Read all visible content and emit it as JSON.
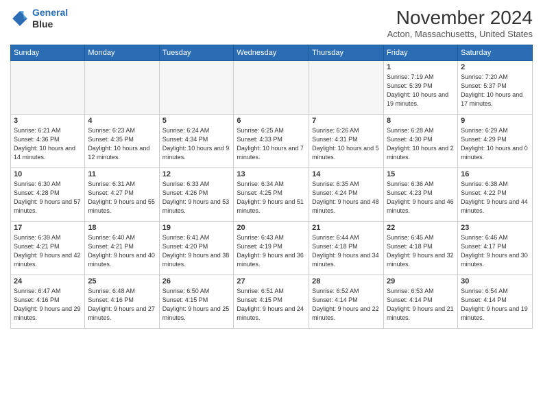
{
  "header": {
    "logo_line1": "General",
    "logo_line2": "Blue",
    "month": "November 2024",
    "location": "Acton, Massachusetts, United States"
  },
  "weekdays": [
    "Sunday",
    "Monday",
    "Tuesday",
    "Wednesday",
    "Thursday",
    "Friday",
    "Saturday"
  ],
  "weeks": [
    [
      {
        "day": "",
        "info": ""
      },
      {
        "day": "",
        "info": ""
      },
      {
        "day": "",
        "info": ""
      },
      {
        "day": "",
        "info": ""
      },
      {
        "day": "",
        "info": ""
      },
      {
        "day": "1",
        "info": "Sunrise: 7:19 AM\nSunset: 5:39 PM\nDaylight: 10 hours and 19 minutes."
      },
      {
        "day": "2",
        "info": "Sunrise: 7:20 AM\nSunset: 5:37 PM\nDaylight: 10 hours and 17 minutes."
      }
    ],
    [
      {
        "day": "3",
        "info": "Sunrise: 6:21 AM\nSunset: 4:36 PM\nDaylight: 10 hours and 14 minutes."
      },
      {
        "day": "4",
        "info": "Sunrise: 6:23 AM\nSunset: 4:35 PM\nDaylight: 10 hours and 12 minutes."
      },
      {
        "day": "5",
        "info": "Sunrise: 6:24 AM\nSunset: 4:34 PM\nDaylight: 10 hours and 9 minutes."
      },
      {
        "day": "6",
        "info": "Sunrise: 6:25 AM\nSunset: 4:33 PM\nDaylight: 10 hours and 7 minutes."
      },
      {
        "day": "7",
        "info": "Sunrise: 6:26 AM\nSunset: 4:31 PM\nDaylight: 10 hours and 5 minutes."
      },
      {
        "day": "8",
        "info": "Sunrise: 6:28 AM\nSunset: 4:30 PM\nDaylight: 10 hours and 2 minutes."
      },
      {
        "day": "9",
        "info": "Sunrise: 6:29 AM\nSunset: 4:29 PM\nDaylight: 10 hours and 0 minutes."
      }
    ],
    [
      {
        "day": "10",
        "info": "Sunrise: 6:30 AM\nSunset: 4:28 PM\nDaylight: 9 hours and 57 minutes."
      },
      {
        "day": "11",
        "info": "Sunrise: 6:31 AM\nSunset: 4:27 PM\nDaylight: 9 hours and 55 minutes."
      },
      {
        "day": "12",
        "info": "Sunrise: 6:33 AM\nSunset: 4:26 PM\nDaylight: 9 hours and 53 minutes."
      },
      {
        "day": "13",
        "info": "Sunrise: 6:34 AM\nSunset: 4:25 PM\nDaylight: 9 hours and 51 minutes."
      },
      {
        "day": "14",
        "info": "Sunrise: 6:35 AM\nSunset: 4:24 PM\nDaylight: 9 hours and 48 minutes."
      },
      {
        "day": "15",
        "info": "Sunrise: 6:36 AM\nSunset: 4:23 PM\nDaylight: 9 hours and 46 minutes."
      },
      {
        "day": "16",
        "info": "Sunrise: 6:38 AM\nSunset: 4:22 PM\nDaylight: 9 hours and 44 minutes."
      }
    ],
    [
      {
        "day": "17",
        "info": "Sunrise: 6:39 AM\nSunset: 4:21 PM\nDaylight: 9 hours and 42 minutes."
      },
      {
        "day": "18",
        "info": "Sunrise: 6:40 AM\nSunset: 4:21 PM\nDaylight: 9 hours and 40 minutes."
      },
      {
        "day": "19",
        "info": "Sunrise: 6:41 AM\nSunset: 4:20 PM\nDaylight: 9 hours and 38 minutes."
      },
      {
        "day": "20",
        "info": "Sunrise: 6:43 AM\nSunset: 4:19 PM\nDaylight: 9 hours and 36 minutes."
      },
      {
        "day": "21",
        "info": "Sunrise: 6:44 AM\nSunset: 4:18 PM\nDaylight: 9 hours and 34 minutes."
      },
      {
        "day": "22",
        "info": "Sunrise: 6:45 AM\nSunset: 4:18 PM\nDaylight: 9 hours and 32 minutes."
      },
      {
        "day": "23",
        "info": "Sunrise: 6:46 AM\nSunset: 4:17 PM\nDaylight: 9 hours and 30 minutes."
      }
    ],
    [
      {
        "day": "24",
        "info": "Sunrise: 6:47 AM\nSunset: 4:16 PM\nDaylight: 9 hours and 29 minutes."
      },
      {
        "day": "25",
        "info": "Sunrise: 6:48 AM\nSunset: 4:16 PM\nDaylight: 9 hours and 27 minutes."
      },
      {
        "day": "26",
        "info": "Sunrise: 6:50 AM\nSunset: 4:15 PM\nDaylight: 9 hours and 25 minutes."
      },
      {
        "day": "27",
        "info": "Sunrise: 6:51 AM\nSunset: 4:15 PM\nDaylight: 9 hours and 24 minutes."
      },
      {
        "day": "28",
        "info": "Sunrise: 6:52 AM\nSunset: 4:14 PM\nDaylight: 9 hours and 22 minutes."
      },
      {
        "day": "29",
        "info": "Sunrise: 6:53 AM\nSunset: 4:14 PM\nDaylight: 9 hours and 21 minutes."
      },
      {
        "day": "30",
        "info": "Sunrise: 6:54 AM\nSunset: 4:14 PM\nDaylight: 9 hours and 19 minutes."
      }
    ]
  ]
}
